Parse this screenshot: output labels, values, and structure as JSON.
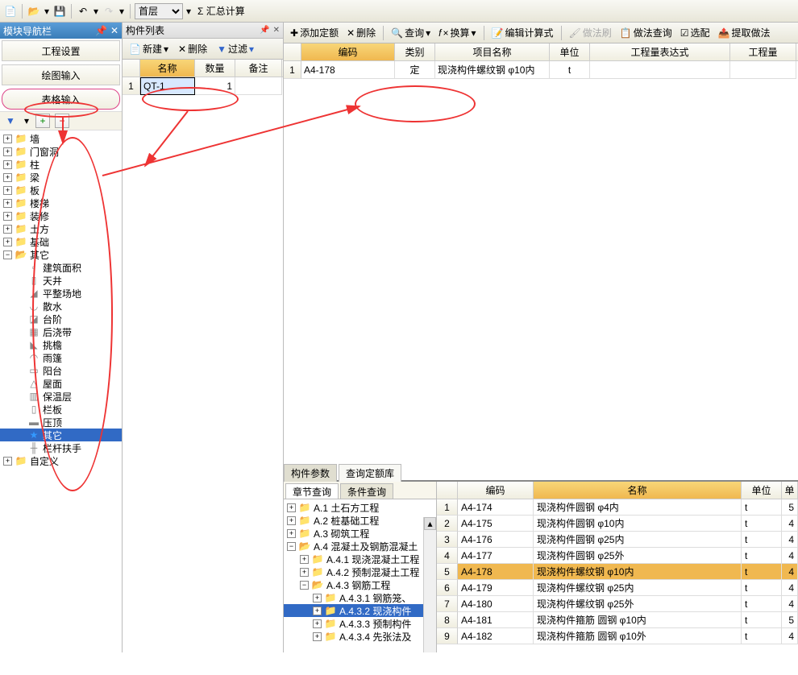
{
  "toolbar": {
    "floor_label": "首层",
    "sum_label": "汇总计算"
  },
  "nav": {
    "title": "模块导航栏",
    "btn1": "工程设置",
    "btn2": "绘图输入",
    "btn3": "表格输入",
    "tree": {
      "wall": "墙",
      "door": "门窗洞",
      "col": "柱",
      "beam": "梁",
      "slab": "板",
      "stair": "楼梯",
      "deco": "装修",
      "earth": "土方",
      "found": "基础",
      "other": "其它",
      "other_children": {
        "bldg_area": "建筑面积",
        "skylight": "天井",
        "level": "平整场地",
        "drain": "散水",
        "step": "台阶",
        "postcast": "后浇带",
        "overhang": "挑檐",
        "canopy": "雨篷",
        "balcony": "阳台",
        "roof": "屋面",
        "insul": "保温层",
        "rail": "栏板",
        "coping": "压顶",
        "misc": "其它",
        "handrail": "栏杆扶手"
      },
      "custom": "自定义"
    }
  },
  "comp": {
    "title": "构件列表",
    "new_btn": "新建",
    "del_btn": "删除",
    "filter_btn": "过滤",
    "col_name": "名称",
    "col_qty": "数量",
    "col_note": "备注",
    "rows": [
      {
        "name": "QT-1",
        "qty": "1",
        "note": ""
      }
    ]
  },
  "main": {
    "add_quota": "添加定额",
    "del": "删除",
    "query": "查询",
    "convert": "换算",
    "edit_formula": "编辑计算式",
    "brush": "做法刷",
    "method_query": "做法查询",
    "select": "选配",
    "extract": "提取做法",
    "col_code": "编码",
    "col_type": "类别",
    "col_proj": "项目名称",
    "col_unit": "单位",
    "col_expr": "工程量表达式",
    "col_qty": "工程量",
    "rows": [
      {
        "code": "A4-178",
        "type": "定",
        "proj": "现浇构件螺纹钢 φ10内",
        "unit": "t",
        "expr": "",
        "qty": ""
      }
    ]
  },
  "bottom": {
    "tab1": "构件参数",
    "tab2": "查询定额库",
    "subtab1": "章节查询",
    "subtab2": "条件查询",
    "tree": {
      "a1": "A.1 土石方工程",
      "a2": "A.2 桩基础工程",
      "a3": "A.3 砌筑工程",
      "a4": "A.4 混凝土及钢筋混凝土",
      "a41": "A.4.1 现浇混凝土工程",
      "a42": "A.4.2 预制混凝土工程",
      "a43": "A.4.3 钢筋工程",
      "a431": "A.4.3.1 钢筋笼、",
      "a432": "A.4.3.2 现浇构件",
      "a433": "A.4.3.3 预制构件",
      "a434": "A.4.3.4 先张法及"
    },
    "col_code": "编码",
    "col_name": "名称",
    "col_unit": "单位",
    "col_sc": "单",
    "rows": [
      {
        "code": "A4-174",
        "name": "现浇构件圆钢 φ4内",
        "unit": "t",
        "sc": "5"
      },
      {
        "code": "A4-175",
        "name": "现浇构件圆钢 φ10内",
        "unit": "t",
        "sc": "4"
      },
      {
        "code": "A4-176",
        "name": "现浇构件圆钢 φ25内",
        "unit": "t",
        "sc": "4"
      },
      {
        "code": "A4-177",
        "name": "现浇构件圆钢 φ25外",
        "unit": "t",
        "sc": "4"
      },
      {
        "code": "A4-178",
        "name": "现浇构件螺纹钢 φ10内",
        "unit": "t",
        "sc": "4"
      },
      {
        "code": "A4-179",
        "name": "现浇构件螺纹钢 φ25内",
        "unit": "t",
        "sc": "4"
      },
      {
        "code": "A4-180",
        "name": "现浇构件螺纹钢 φ25外",
        "unit": "t",
        "sc": "4"
      },
      {
        "code": "A4-181",
        "name": "现浇构件箍筋 圆钢 φ10内",
        "unit": "t",
        "sc": "5"
      },
      {
        "code": "A4-182",
        "name": "现浇构件箍筋 圆钢 φ10外",
        "unit": "t",
        "sc": "4"
      }
    ]
  }
}
